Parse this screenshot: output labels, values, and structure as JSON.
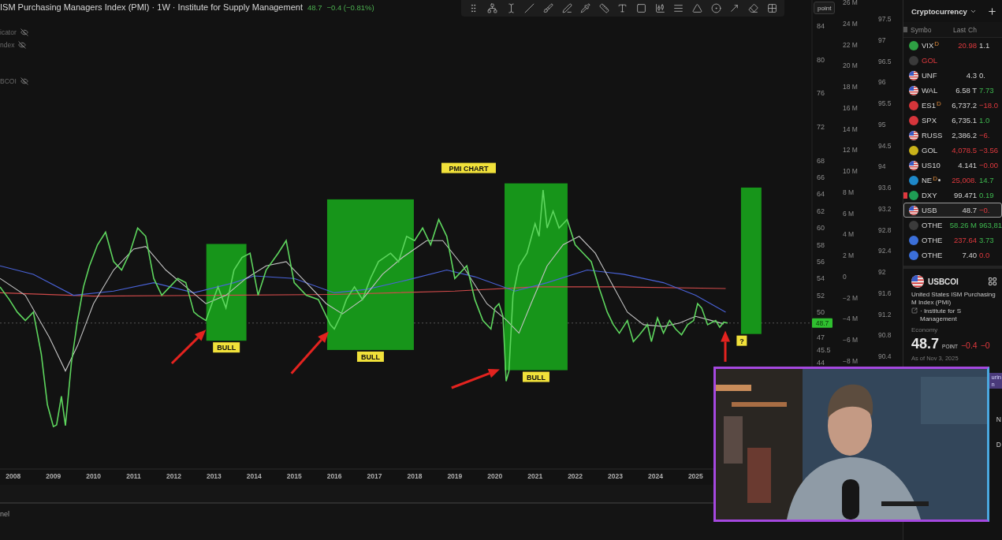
{
  "legend": {
    "title": "ISM Purchasing Managers Index (PMI) · 1W · Institute for Supply Management",
    "value": "48.7",
    "change": "−0.4 (−0.81%)",
    "hidden_rows": [
      "icator",
      "ndex",
      "BCOI"
    ]
  },
  "scale_button": "point",
  "chart": {
    "axis_2_labels": [
      "26 M",
      "24 M",
      "22 M",
      "20 M",
      "18 M",
      "16 M",
      "14 M",
      "12 M",
      "10 M",
      "8 M",
      "6 M",
      "4 M",
      "2 M",
      "0",
      "−2 M",
      "−4 M",
      "−6 M",
      "−8 M"
    ],
    "axis_3_labels": [
      "97.5",
      "97",
      "96.5",
      "96",
      "95.5",
      "95",
      "94.5",
      "94",
      "93.6",
      "93.2",
      "92.8",
      "92.4",
      "92",
      "91.6",
      "91.2",
      "90.8",
      "90.4"
    ],
    "highlights": [
      {
        "label": "BULL"
      },
      {
        "label": "BULL"
      },
      {
        "label": "BULL"
      },
      {
        "label": "?"
      }
    ],
    "chart_data": {
      "type": "line",
      "xlim": [
        2007.67,
        2027.9
      ],
      "ylim": [
        31.35,
        87.09
      ],
      "xticks": [
        {
          "value": 2008,
          "label": "2008"
        },
        {
          "value": 2009,
          "label": "2009"
        },
        {
          "value": 2010,
          "label": "2010"
        },
        {
          "value": 2011,
          "label": "2011"
        },
        {
          "value": 2012,
          "label": "2012"
        },
        {
          "value": 2013,
          "label": "2013"
        },
        {
          "value": 2014,
          "label": "2014"
        },
        {
          "value": 2015,
          "label": "2015"
        },
        {
          "value": 2016,
          "label": "2016"
        },
        {
          "value": 2017,
          "label": "2017"
        },
        {
          "value": 2018,
          "label": "2018"
        },
        {
          "value": 2019,
          "label": "2019"
        },
        {
          "value": 2020,
          "label": "2020"
        },
        {
          "value": 2021,
          "label": "2021"
        },
        {
          "value": 2022,
          "label": "2022"
        },
        {
          "value": 2023,
          "label": "2023"
        },
        {
          "value": 2024,
          "label": "2024"
        },
        {
          "value": 2025,
          "label": "2025"
        }
      ],
      "yticks": [
        {
          "value": 84,
          "label": "84"
        },
        {
          "value": 80,
          "label": "80"
        },
        {
          "value": 76,
          "label": "76"
        },
        {
          "value": 72,
          "label": "72"
        },
        {
          "value": 68,
          "label": "68"
        },
        {
          "value": 66,
          "label": "66"
        },
        {
          "value": 64,
          "label": "64"
        },
        {
          "value": 62,
          "label": "62"
        },
        {
          "value": 60,
          "label": "60"
        },
        {
          "value": 58,
          "label": "58"
        },
        {
          "value": 56,
          "label": "56"
        },
        {
          "value": 54,
          "label": "54"
        },
        {
          "value": 52,
          "label": "52"
        },
        {
          "value": 50,
          "label": "50"
        },
        {
          "value": 47,
          "label": "47"
        },
        {
          "value": 45.5,
          "label": "45.5"
        },
        {
          "value": 44,
          "label": "44"
        }
      ],
      "ref_lines": [
        {
          "axis": "y",
          "value": 48.7,
          "label": "48.7"
        }
      ],
      "series": [
        {
          "color": "#5ed65e",
          "x": [
            2007.67,
            2007.9,
            2008.1,
            2008.3,
            2008.5,
            2008.7,
            2008.85,
            2009.0,
            2009.08,
            2009.2,
            2009.3,
            2009.45,
            2009.6,
            2009.75,
            2009.9,
            2010.1,
            2010.3,
            2010.5,
            2010.7,
            2010.9,
            2011.1,
            2011.3,
            2011.5,
            2011.7,
            2011.9,
            2012.1,
            2012.3,
            2012.5,
            2012.6,
            2012.8,
            2012.95,
            2013.1,
            2013.3,
            2013.5,
            2013.7,
            2013.9,
            2014.1,
            2014.3,
            2014.6,
            2014.8,
            2015.0,
            2015.3,
            2015.6,
            2015.9,
            2016.0,
            2016.15,
            2016.3,
            2016.5,
            2016.7,
            2016.9,
            2017.1,
            2017.4,
            2017.6,
            2017.8,
            2018.0,
            2018.2,
            2018.4,
            2018.6,
            2018.8,
            2019.0,
            2019.3,
            2019.5,
            2019.7,
            2019.9,
            2020.0,
            2020.1,
            2020.2,
            2020.28,
            2020.35,
            2020.45,
            2020.6,
            2020.8,
            2021.0,
            2021.1,
            2021.2,
            2021.3,
            2021.45,
            2021.6,
            2021.8,
            2022.0,
            2022.2,
            2022.4,
            2022.6,
            2022.8,
            2022.95,
            2023.1,
            2023.3,
            2023.45,
            2023.6,
            2023.8,
            2023.9,
            2024.05,
            2024.2,
            2024.35,
            2024.5,
            2024.65,
            2024.8,
            2024.95,
            2025.05,
            2025.15,
            2025.3,
            2025.5,
            2025.6,
            2025.7,
            2025.8
          ],
          "values": [
            53,
            51.5,
            50,
            49,
            50,
            45,
            39,
            36.4,
            36.6,
            40,
            36.5,
            44,
            49,
            53,
            55.5,
            58,
            59.5,
            56,
            55,
            57,
            60,
            59,
            54,
            52,
            53,
            54,
            53.5,
            50,
            49.6,
            49,
            51,
            53,
            50.5,
            55,
            56.5,
            57,
            52,
            55,
            57,
            58.5,
            53.5,
            52,
            51.5,
            48.5,
            48,
            49.5,
            51.5,
            53,
            51.5,
            54,
            56,
            57,
            56,
            59,
            58.5,
            60,
            58,
            61,
            59,
            54,
            55.5,
            51.5,
            49,
            48,
            50.5,
            51,
            49.5,
            41.8,
            43,
            52,
            55.5,
            57,
            60.5,
            59,
            64.5,
            60,
            62,
            60,
            61,
            58,
            57,
            56,
            52.8,
            50,
            48.5,
            47.5,
            49,
            46.5,
            47.3,
            48.5,
            46.5,
            49.3,
            47.5,
            49,
            48,
            47.3,
            48.5,
            49,
            51,
            50.5,
            48.5,
            49,
            48.2,
            48.8,
            48.7
          ]
        },
        {
          "color": "#c4c4c4",
          "x": [
            2007.67,
            2008.3,
            2008.9,
            2009.3,
            2009.6,
            2010.0,
            2010.5,
            2011.0,
            2011.3,
            2011.8,
            2012.3,
            2012.8,
            2013.3,
            2013.8,
            2014.3,
            2014.8,
            2015.3,
            2015.8,
            2016.2,
            2016.7,
            2017.2,
            2017.7,
            2018.3,
            2018.7,
            2019.2,
            2019.8,
            2020.3,
            2020.6,
            2020.9,
            2021.3,
            2021.7,
            2022.1,
            2022.5,
            2022.9,
            2023.3,
            2023.7,
            2024.2,
            2024.6,
            2025.0,
            2025.4,
            2025.7
          ],
          "values": [
            54,
            52,
            47,
            43,
            46,
            51,
            55,
            57.5,
            57.8,
            55,
            53,
            51,
            52,
            54,
            55.5,
            56,
            53.5,
            51,
            49.8,
            51.5,
            54.5,
            56.5,
            58.5,
            58.5,
            55.5,
            51,
            49,
            47.5,
            51,
            55.5,
            58,
            59,
            57,
            53.5,
            50,
            48.5,
            48.3,
            48.7,
            49.5,
            49,
            48.6
          ]
        },
        {
          "color": "#4a63d9",
          "x": [
            2007.67,
            2008.5,
            2009.5,
            2010.5,
            2011.5,
            2012.5,
            2013.5,
            2014.0,
            2015.0,
            2016.0,
            2016.8,
            2017.8,
            2018.8,
            2019.5,
            2020.5,
            2021.3,
            2022.3,
            2023.2,
            2024.2,
            2025.0,
            2025.75
          ],
          "values": [
            55.5,
            54.5,
            52,
            52.5,
            53.5,
            52.3,
            53.5,
            54.3,
            54,
            52.3,
            52.7,
            53.8,
            55,
            54.2,
            52.5,
            53.5,
            55,
            54.5,
            53.5,
            52,
            50
          ]
        },
        {
          "color": "#d04a4a",
          "x": [
            2007.67,
            2010,
            2013,
            2016,
            2019,
            2021,
            2023,
            2025.75
          ],
          "values": [
            52.3,
            51.9,
            52,
            52.1,
            52.5,
            53,
            53,
            52.8
          ]
        }
      ],
      "annotations": [
        "PMI CHART"
      ]
    }
  },
  "bottom_bar": {
    "label": "nel"
  },
  "watchlist": {
    "title": "Cryptocurrency",
    "columns": [
      "Symbo",
      "Last",
      "Ch"
    ],
    "rows": [
      {
        "symbol": "VIX",
        "badge": "D",
        "dot": false,
        "invalid": false,
        "last": {
          "text": "20.98",
          "rising": false,
          "falling": true
        },
        "change": {
          "text": "1.1",
          "rising": false,
          "falling": false
        },
        "icon": {
          "kind": "badge",
          "color": "#2ea043"
        },
        "selected": false,
        "flagged": false
      },
      {
        "symbol": "GOL",
        "dot": false,
        "invalid": true,
        "icon": {
          "kind": "badge",
          "color": "#3a3a3a"
        },
        "selected": false,
        "flagged": false
      },
      {
        "symbol": "UNF",
        "dot": false,
        "invalid": false,
        "last": {
          "text": "4.3",
          "rising": false,
          "falling": false
        },
        "change": {
          "text": "0.",
          "rising": false,
          "falling": false
        },
        "icon": {
          "kind": "flag"
        },
        "selected": false,
        "flagged": false
      },
      {
        "symbol": "WAL",
        "dot": false,
        "invalid": false,
        "last": {
          "text": "6.58 T",
          "rising": false,
          "falling": false
        },
        "change": {
          "text": "7.73",
          "rising": true,
          "falling": false
        },
        "icon": {
          "kind": "flag"
        },
        "selected": false,
        "flagged": false
      },
      {
        "symbol": "ES1",
        "badge": "D",
        "dot": false,
        "invalid": false,
        "last": {
          "text": "6,737.2",
          "rising": false,
          "falling": false
        },
        "change": {
          "text": "−18.0",
          "rising": false,
          "falling": true
        },
        "icon": {
          "kind": "badge",
          "color": "#d6353a"
        },
        "selected": false,
        "flagged": false
      },
      {
        "symbol": "SPX",
        "dot": false,
        "invalid": false,
        "last": {
          "text": "6,735.1",
          "rising": false,
          "falling": false
        },
        "change": {
          "text": "1.0",
          "rising": true,
          "falling": false
        },
        "icon": {
          "kind": "badge",
          "color": "#d6353b"
        },
        "selected": false,
        "flagged": false
      },
      {
        "symbol": "RUSS",
        "dot": false,
        "invalid": false,
        "last": {
          "text": "2,386.2",
          "rising": false,
          "falling": false
        },
        "change": {
          "text": "−6.",
          "rising": false,
          "falling": true
        },
        "icon": {
          "kind": "flag"
        },
        "selected": false,
        "flagged": false
      },
      {
        "symbol": "GOL",
        "dot": false,
        "invalid": false,
        "last": {
          "text": "4,078.5",
          "rising": false,
          "falling": true
        },
        "change": {
          "text": "−3.56",
          "rising": false,
          "falling": true
        },
        "icon": {
          "kind": "badge",
          "color": "#c9b21a"
        },
        "selected": false,
        "flagged": false
      },
      {
        "symbol": "US10",
        "dot": false,
        "invalid": false,
        "last": {
          "text": "4.141",
          "rising": false,
          "falling": false
        },
        "change": {
          "text": "−0.00",
          "rising": false,
          "falling": true
        },
        "icon": {
          "kind": "flag"
        },
        "selected": false,
        "flagged": false
      },
      {
        "symbol": "NE",
        "badge": "D",
        "dot": true,
        "invalid": false,
        "last": {
          "text": "25,008.",
          "rising": false,
          "falling": true
        },
        "change": {
          "text": "14.7",
          "rising": true,
          "falling": false
        },
        "icon": {
          "kind": "badge",
          "color": "#1e88c9"
        },
        "selected": false,
        "flagged": false
      },
      {
        "symbol": "DXY",
        "dot": false,
        "invalid": false,
        "last": {
          "text": "99.471",
          "rising": false,
          "falling": false
        },
        "change": {
          "text": "0.19",
          "rising": true,
          "falling": false
        },
        "icon": {
          "kind": "badge",
          "color": "#1f9d55"
        },
        "selected": false,
        "flagged": true
      },
      {
        "symbol": "USB",
        "dot": false,
        "invalid": false,
        "last": {
          "text": "48.7",
          "rising": false,
          "falling": false
        },
        "change": {
          "text": "−0.",
          "rising": false,
          "falling": true
        },
        "icon": {
          "kind": "flag"
        },
        "selected": true,
        "flagged": false
      },
      {
        "symbol": "OTHE",
        "dot": false,
        "invalid": false,
        "last": {
          "text": "58.26 M",
          "rising": true,
          "falling": false
        },
        "change": {
          "text": "963,81",
          "rising": true,
          "falling": false
        },
        "icon": {
          "kind": "badge",
          "color": "#3b3b3b"
        },
        "selected": false,
        "flagged": false
      },
      {
        "symbol": "OTHE",
        "dot": false,
        "invalid": false,
        "last": {
          "text": "237.64",
          "rising": false,
          "falling": true
        },
        "change": {
          "text": "3.73",
          "rising": true,
          "falling": false
        },
        "icon": {
          "kind": "badge",
          "color": "#3b6fd9"
        },
        "selected": false,
        "flagged": false
      },
      {
        "symbol": "OTHE",
        "dot": false,
        "invalid": false,
        "last": {
          "text": "7.40",
          "rising": false,
          "falling": false
        },
        "change": {
          "text": "0.0",
          "rising": false,
          "falling": true
        },
        "icon": {
          "kind": "badge",
          "color": "#3b6fda"
        },
        "selected": false,
        "flagged": false
      }
    ],
    "detail": {
      "symbol": "USBCOI",
      "description_before_link": "United States ISM Purchasing M Index (PMI)",
      "description_after_link": "· Institute for S Management",
      "category": "Economy",
      "price": "48.7",
      "unit": "POINT",
      "change": "−0.4",
      "change_percent": "−0",
      "as_of": "As of Nov 3, 2025"
    },
    "chip_lines": [
      "urin",
      "n"
    ],
    "side_fragments": [
      "N",
      "D"
    ]
  }
}
